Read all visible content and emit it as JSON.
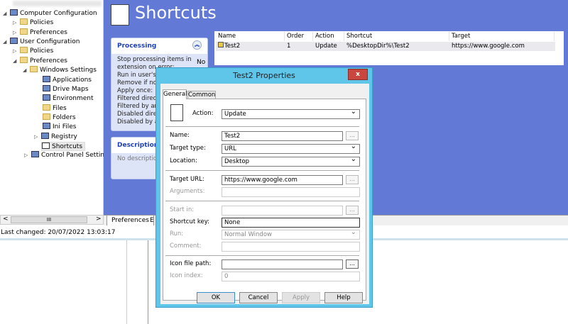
{
  "tree": [
    {
      "label": "Computer Configuration",
      "expanded": true,
      "icon": "computer-icon"
    },
    {
      "label": "Policies",
      "icon": "folder-icon"
    },
    {
      "label": "Preferences",
      "icon": "folder-icon"
    },
    {
      "label": "User Configuration",
      "expanded": true,
      "icon": "user-icon"
    },
    {
      "label": "Policies",
      "icon": "folder-icon"
    },
    {
      "label": "Preferences",
      "icon": "folder-icon"
    },
    {
      "label": "Windows Settings",
      "icon": "folder-icon"
    },
    {
      "label": "Applications",
      "icon": "applications-icon"
    },
    {
      "label": "Drive Maps",
      "icon": "drive-maps-icon"
    },
    {
      "label": "Environment",
      "icon": "environment-icon"
    },
    {
      "label": "Files",
      "icon": "files-icon"
    },
    {
      "label": "Folders",
      "icon": "folders-icon"
    },
    {
      "label": "Ini Files",
      "icon": "ini-files-icon"
    },
    {
      "label": "Registry",
      "icon": "registry-icon"
    },
    {
      "label": "Shortcuts",
      "icon": "shortcut-icon",
      "selected": true
    },
    {
      "label": "Control Panel Settings",
      "icon": "control-panel-icon"
    }
  ],
  "scrollbar": {
    "thumb": "III"
  },
  "main": {
    "title": "Shortcuts",
    "processing": {
      "title": "Processing",
      "rows": [
        "Stop processing items in",
        "extension on error:",
        "Run in user's",
        "Remove if no",
        "Apply once:",
        "Filtered direc",
        "Filtered by an",
        "Disabled dire",
        "Disabled by a"
      ],
      "value": "No"
    },
    "description": {
      "title": "Description",
      "text": "No descriptio"
    },
    "table": {
      "headers": [
        "Name",
        "Order",
        "Action",
        "Shortcut",
        "Target"
      ],
      "row": [
        "Test2",
        "1",
        "Update",
        "%DesktopDir%\\Test2",
        "https://www.google.com"
      ]
    },
    "tabs": [
      "Preferences",
      "E"
    ]
  },
  "status": "Last changed: 20/07/2022 13:03:17",
  "dialog": {
    "title": "Test2 Properties",
    "close": "x",
    "tabs": [
      "General",
      "Common"
    ],
    "action_label": "Action:",
    "action": "Update",
    "name_label": "Name:",
    "name": "Test2",
    "target_type_label": "Target type:",
    "target_type": "URL",
    "location_label": "Location:",
    "location": "Desktop",
    "target_url_label": "Target URL:",
    "target_url": "https://www.google.com",
    "arguments_label": "Arguments:",
    "start_in_label": "Start in:",
    "shortcut_key_label": "Shortcut key:",
    "shortcut_key": "None",
    "run_label": "Run:",
    "run": "Normal Window",
    "comment_label": "Comment:",
    "icon_path_label": "Icon file path:",
    "icon_index_label": "Icon index:",
    "icon_index": "0",
    "browse": "...",
    "buttons": [
      "OK",
      "Cancel",
      "Apply",
      "Help"
    ]
  }
}
